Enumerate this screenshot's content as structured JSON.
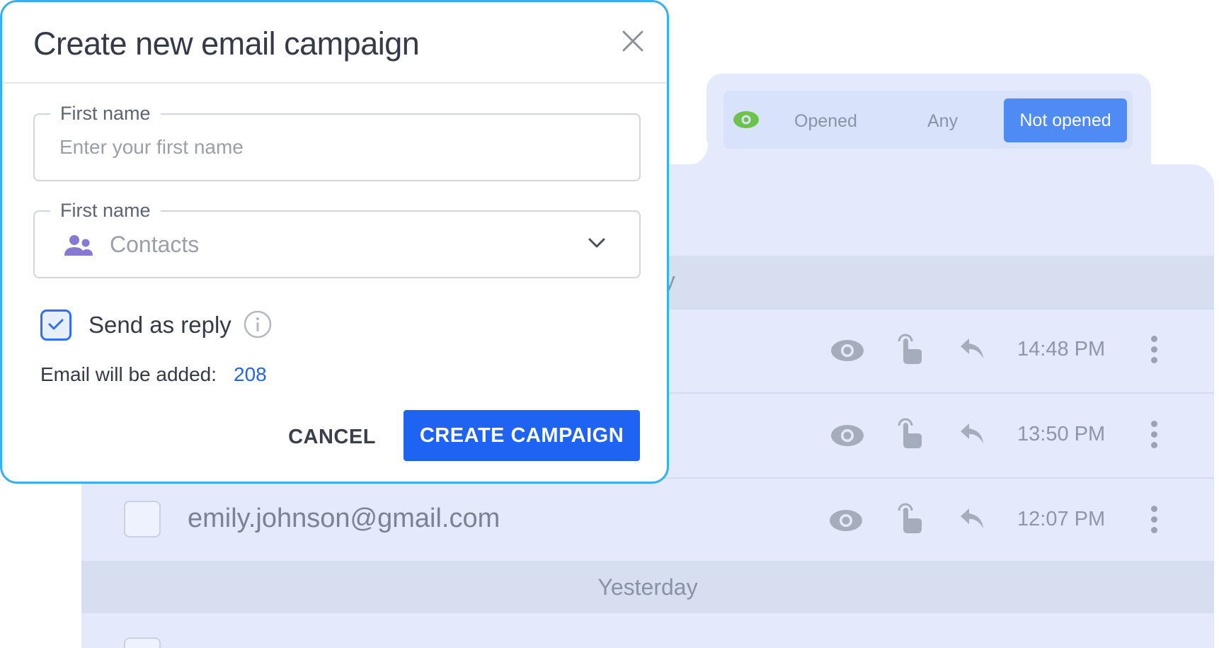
{
  "modal": {
    "title": "Create new email campaign",
    "field1": {
      "legend": "First name",
      "placeholder": "Enter your first name"
    },
    "field2": {
      "legend": "First name",
      "value": "Contacts"
    },
    "send_as_reply_label": "Send as reply",
    "send_as_reply_checked": true,
    "email_added_label": "Email will be added:",
    "email_added_count": "208",
    "cancel_label": "CANCEL",
    "create_label": "CREATE CAMPAIGN"
  },
  "filter": {
    "opened_label": "Opened",
    "any_label": "Any",
    "not_opened_label": "Not opened",
    "selected": "Not opened"
  },
  "groups": {
    "today_partial": "ay",
    "yesterday": "Yesterday"
  },
  "rows": [
    {
      "email": "",
      "time": "14:48 PM"
    },
    {
      "email": "",
      "time": "13:50 PM"
    },
    {
      "email": "emily.johnson@gmail.com",
      "time": "12:07 PM"
    }
  ],
  "colors": {
    "accent": "#1e63f2",
    "modal_border": "#34b1ee",
    "panel_bg": "#e4eafb",
    "opened_eye": "#6cc24a"
  }
}
